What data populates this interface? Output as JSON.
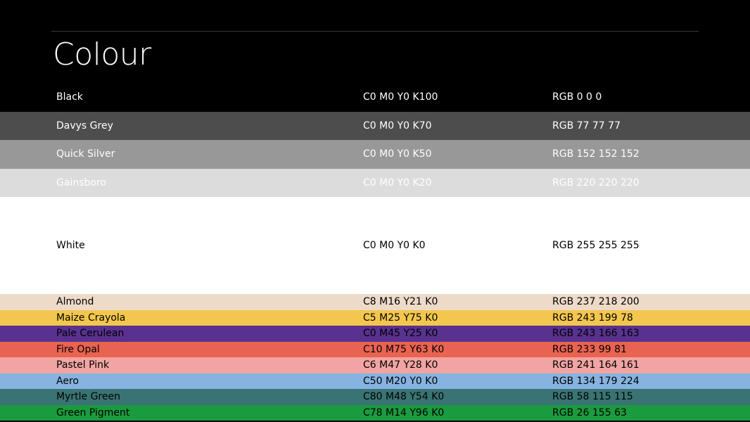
{
  "title": "Colour",
  "colours": [
    {
      "name": "Black",
      "cmyk": "C0 M0 Y0 K100",
      "rgb": "RGB 0 0 0",
      "swatch": "#000000",
      "text": "#ffffff",
      "size": "h-40"
    },
    {
      "name": "Davys Grey",
      "cmyk": "C0 M0 Y0 K70",
      "rgb": "RGB 77 77 77",
      "swatch": "#4d4d4d",
      "text": "#ffffff",
      "size": "h-40"
    },
    {
      "name": "Quick Silver",
      "cmyk": "C0 M0 Y0 K50",
      "rgb": "RGB 152 152 152",
      "swatch": "#989898",
      "text": "#ffffff",
      "size": "h-40"
    },
    {
      "name": "Gainsboro",
      "cmyk": "C0 M0 Y0 K20",
      "rgb": "RGB 220 220 220",
      "swatch": "#dcdcdc",
      "text": "#ffffff",
      "size": "h-40"
    },
    {
      "name": "White",
      "cmyk": "C0 M0 Y0 K0",
      "rgb": "RGB 255 255 255",
      "swatch": "#ffffff",
      "text": "#000000",
      "size": "h-138"
    },
    {
      "name": "Almond",
      "cmyk": "C8 M16 Y21 K0",
      "rgb": "RGB 237 218 200",
      "swatch": "#eddac8",
      "text": "#000000",
      "size": "h-22"
    },
    {
      "name": "Maize Crayola",
      "cmyk": "C5 M25 Y75 K0",
      "rgb": "RGB 243 199 78",
      "swatch": "#f3c74e",
      "text": "#000000",
      "size": "h-22"
    },
    {
      "name": "Pale Cerulean",
      "cmyk": "C0 M45 Y25 K0",
      "rgb": "RGB 243 166 163",
      "swatch": "#59318f",
      "text": "#000000",
      "size": "h-22"
    },
    {
      "name": "Fire Opal",
      "cmyk": "C10 M75 Y63 K0",
      "rgb": "RGB 233 99 81",
      "swatch": "#e96351",
      "text": "#000000",
      "size": "h-22"
    },
    {
      "name": "Pastel Pink",
      "cmyk": "C6 M47 Y28 K0",
      "rgb": "RGB 241 164 161",
      "swatch": "#f1a4a1",
      "text": "#000000",
      "size": "h-22"
    },
    {
      "name": "Aero",
      "cmyk": "C50 M20 Y0 K0",
      "rgb": "RGB 134 179 224",
      "swatch": "#86b3e0",
      "text": "#000000",
      "size": "h-22"
    },
    {
      "name": "Myrtle Green",
      "cmyk": "C80 M48 Y54 K0",
      "rgb": "RGB 58 115 115",
      "swatch": "#3a7373",
      "text": "#000000",
      "size": "h-22"
    },
    {
      "name": "Green Pigment",
      "cmyk": "C78 M14 Y96 K0",
      "rgb": "RGB 26 155 63",
      "swatch": "#1a9b3f",
      "text": "#000000",
      "size": "h-22"
    }
  ]
}
